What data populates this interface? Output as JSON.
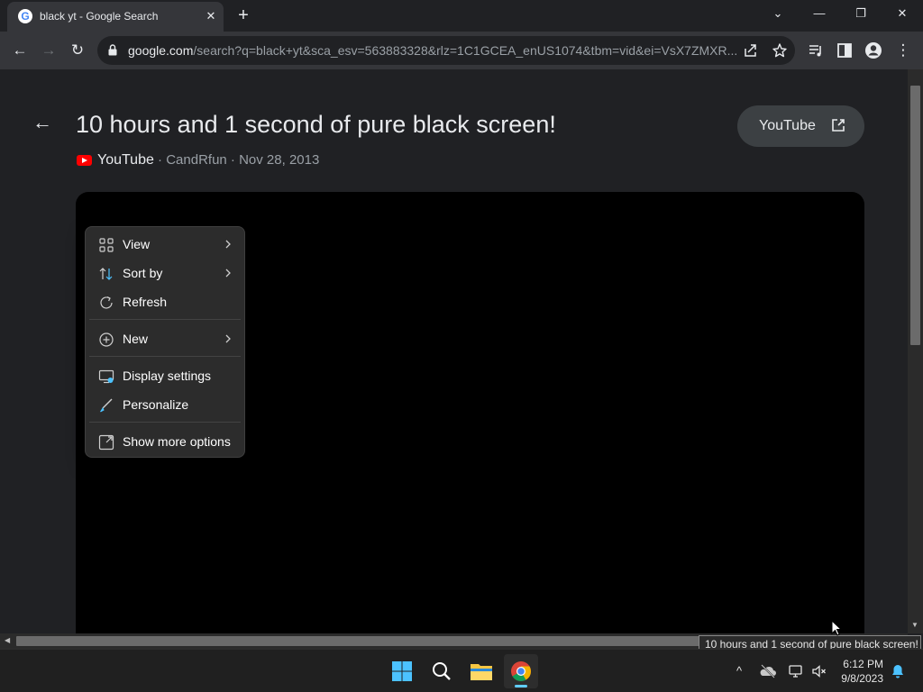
{
  "browser": {
    "tab": {
      "title": "black yt - Google Search",
      "favicon_letter": "G",
      "close_glyph": "✕"
    },
    "new_tab_glyph": "+",
    "window_controls": {
      "tab_search": "⌄",
      "minimize": "—",
      "restore": "❐",
      "close": "✕"
    },
    "toolbar": {
      "back_glyph": "←",
      "forward_glyph": "→",
      "reload_glyph": "↻",
      "menu_glyph": "⋮"
    },
    "address": {
      "host": "google.com",
      "path": "/search?q=black+yt&sca_esv=563883328&rlz=1C1GCEA_enUS1074&tbm=vid&ei=VsX7ZMXR..."
    }
  },
  "video_panel": {
    "back_glyph": "←",
    "title": "10 hours and 1 second of pure black screen!",
    "source": "YouTube",
    "meta_rest": " · CandRfun · Nov 28, 2013",
    "open_button_label": "YouTube"
  },
  "context_menu": {
    "items": [
      {
        "label": "View",
        "icon": "grid-icon",
        "submenu": true
      },
      {
        "label": "Sort by",
        "icon": "sort-icon",
        "submenu": true
      },
      {
        "label": "Refresh",
        "icon": "refresh-icon",
        "submenu": false
      },
      {
        "label": "New",
        "icon": "plus-circle-icon",
        "submenu": true
      },
      {
        "label": "Display settings",
        "icon": "display-icon",
        "submenu": false
      },
      {
        "label": "Personalize",
        "icon": "brush-icon",
        "submenu": false
      },
      {
        "label": "Show more options",
        "icon": "expand-icon",
        "submenu": false
      }
    ]
  },
  "tooltip": "10 hours and 1 second of pure black screen!",
  "taskbar": {
    "apps": [
      "windows-start-icon",
      "search-icon",
      "file-explorer-icon",
      "chrome-icon"
    ],
    "tray": {
      "chevron_glyph": "^"
    },
    "clock": {
      "time": "6:12 PM",
      "date": "9/8/2023"
    }
  },
  "colors": {
    "background": "#202124",
    "toolbar": "#35363a",
    "menu": "#2c2c2c",
    "youtube_red": "#ff0000",
    "accent": "#60cdff"
  }
}
